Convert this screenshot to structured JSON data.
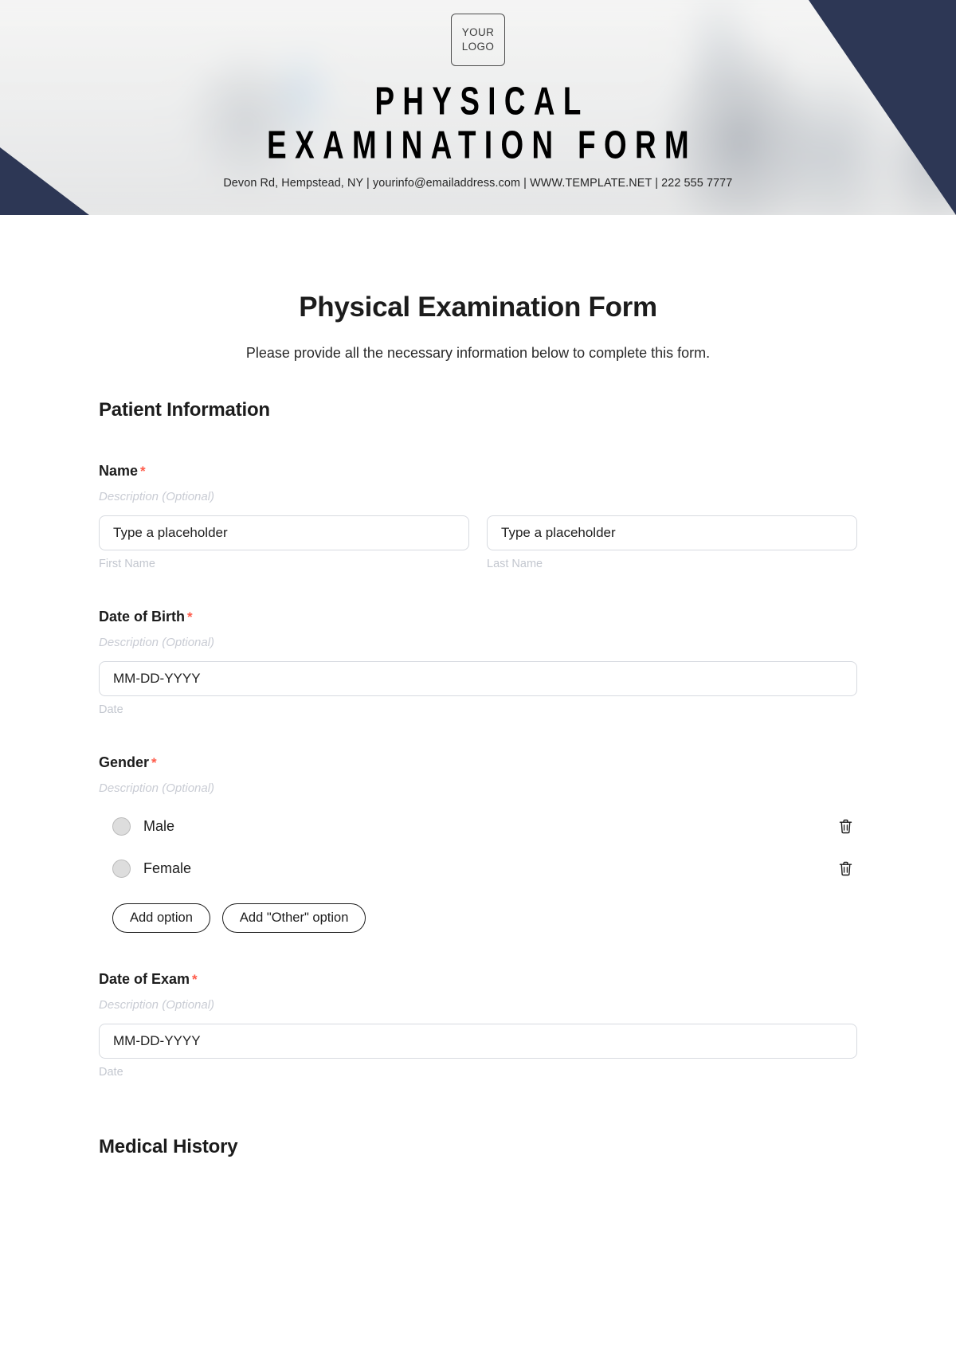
{
  "banner": {
    "logo": {
      "line1": "YOUR",
      "line2": "LOGO"
    },
    "title_line1": "PHYSICAL",
    "title_line2": "EXAMINATION FORM",
    "contact": "Devon Rd, Hempstead, NY | yourinfo@emailaddress.com | WWW.TEMPLATE.NET | 222 555 7777",
    "accent_navy": "#2d3755"
  },
  "form": {
    "title": "Physical Examination Form",
    "subtitle": "Please provide all the necessary information below to complete this form.",
    "required_marker": "*",
    "required_color": "#ff5b4a",
    "description_placeholder": "Description (Optional)",
    "sections": [
      {
        "heading": "Patient Information"
      },
      {
        "heading": "Medical History"
      }
    ],
    "fields": {
      "name": {
        "label": "Name",
        "description": "Description (Optional)",
        "first": {
          "placeholder": "Type a placeholder",
          "sub_label": "First Name"
        },
        "last": {
          "placeholder": "Type a placeholder",
          "sub_label": "Last Name"
        }
      },
      "date_of_birth": {
        "label": "Date of Birth",
        "description": "Description (Optional)",
        "placeholder": "MM-DD-YYYY",
        "sub_label": "Date"
      },
      "gender": {
        "label": "Gender",
        "description": "Description (Optional)",
        "options": [
          {
            "label": "Male"
          },
          {
            "label": "Female"
          }
        ],
        "add_option_label": "Add option",
        "add_other_label": "Add \"Other\" option"
      },
      "date_of_exam": {
        "label": "Date of Exam",
        "description": "Description (Optional)",
        "placeholder": "MM-DD-YYYY",
        "sub_label": "Date"
      }
    }
  }
}
